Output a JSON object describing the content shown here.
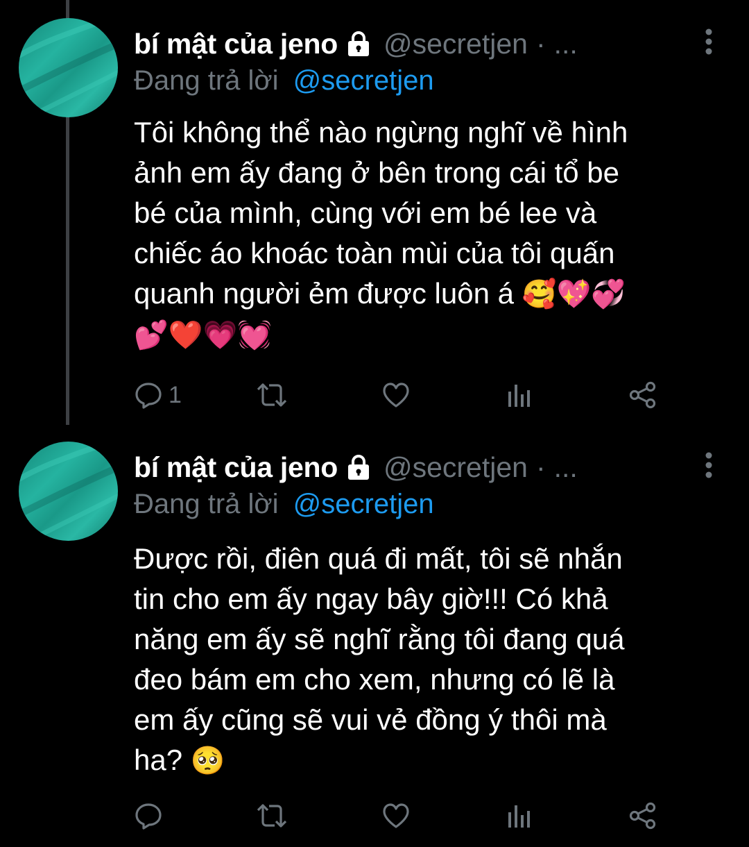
{
  "tweets": [
    {
      "author_name": "bí mật của jeno",
      "handle": "@secretjen",
      "separator": "·",
      "time": "...",
      "replying_prefix": "Đang trả lời",
      "replying_to": "@secretjen",
      "text": "Tôi không thể nào ngừng nghĩ về hình\nảnh em ấy đang ở bên trong cái tổ be\nbé của mình, cùng với em bé lee và\nchiếc áo khoác toàn mùi của tôi quấn\nquanh người ẻm được luôn á ",
      "emojis": "🥰💖💞\n💕❤️💗💓",
      "reply_count": "1"
    },
    {
      "author_name": "bí mật của jeno",
      "handle": "@secretjen",
      "separator": "·",
      "time": "...",
      "replying_prefix": "Đang trả lời",
      "replying_to": "@secretjen",
      "text": "Được rồi, điên quá đi mất, tôi sẽ nhắn\ntin cho em ấy ngay bây giờ!!! Có khả\nnăng em ấy sẽ nghĩ rằng tôi đang quá\nđeo bám em cho xem, nhưng có lẽ là\nem ấy cũng sẽ vui vẻ đồng ý thôi mà\nha? ",
      "emojis": "🥺",
      "reply_count": ""
    }
  ],
  "icons": {
    "protected": "lock-icon",
    "more": "more-vertical-icon",
    "reply": "reply-icon",
    "retweet": "retweet-icon",
    "like": "heart-icon",
    "analytics": "analytics-icon",
    "share": "share-icon"
  },
  "colors": {
    "background": "#000000",
    "text": "#ffffff",
    "secondary": "#6e767d",
    "link": "#1d9bf0",
    "thread_line": "#3d4044",
    "avatar": "#1fa592"
  }
}
